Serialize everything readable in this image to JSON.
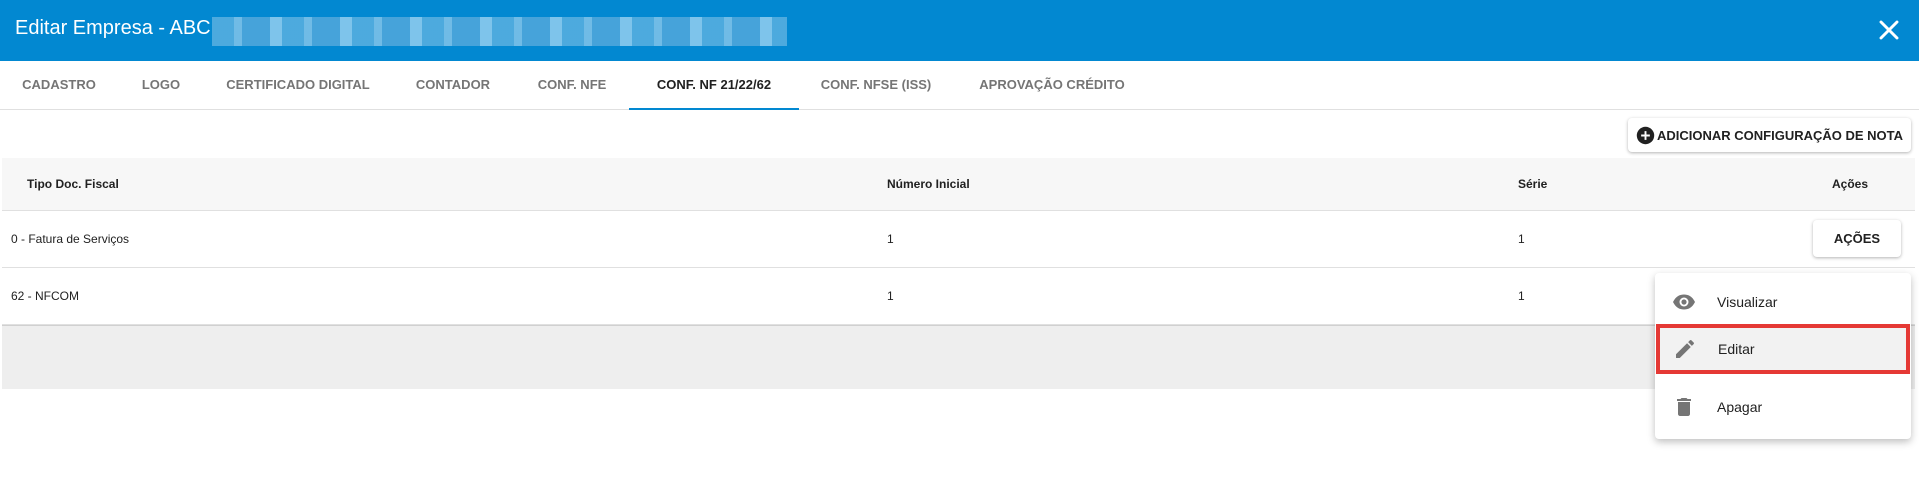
{
  "dialog": {
    "title": "Editar Empresa - ABC ",
    "close_icon": "close-icon"
  },
  "tabs": [
    {
      "label": "CADASTRO"
    },
    {
      "label": "LOGO"
    },
    {
      "label": "CERTIFICADO DIGITAL"
    },
    {
      "label": "CONTADOR"
    },
    {
      "label": "CONF. NFE"
    },
    {
      "label": "CONF. NF 21/22/62"
    },
    {
      "label": "CONF. NFSE (ISS)"
    },
    {
      "label": "APROVAÇÃO CRÉDITO"
    }
  ],
  "active_tab": "CONF. NF 21/22/62",
  "add_button": {
    "label": "ADICIONAR CONFIGURAÇÃO DE NOTA",
    "icon": "plus-circle-icon"
  },
  "table": {
    "headers": [
      "Tipo Doc. Fiscal",
      "Número Inicial",
      "Série",
      "Ações"
    ],
    "rows": [
      {
        "tipo": "0 - Fatura de Serviços",
        "numero": "1",
        "serie": "1"
      },
      {
        "tipo": "62 - NFCOM",
        "numero": "1",
        "serie": "1"
      }
    ]
  },
  "actions_button": {
    "label": "AÇÕES"
  },
  "actions_menu": [
    {
      "label": "Visualizar",
      "icon": "eye-icon"
    },
    {
      "label": "Editar",
      "icon": "pencil-icon"
    },
    {
      "label": "Apagar",
      "icon": "trash-icon"
    }
  ],
  "colors": {
    "primary": "#0288d1",
    "highlight": "#e53935"
  }
}
